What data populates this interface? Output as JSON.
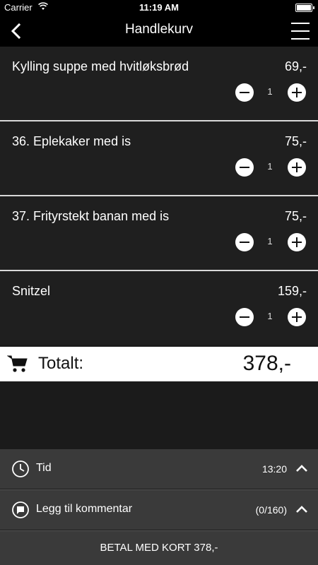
{
  "status_bar": {
    "carrier": "Carrier",
    "time": "11:19 AM"
  },
  "nav": {
    "title": "Handlekurv"
  },
  "items": [
    {
      "name": "Kylling suppe med hvitløksbrød",
      "price": "69,-",
      "qty": "1"
    },
    {
      "name": "36. Eplekaker med is",
      "price": "75,-",
      "qty": "1"
    },
    {
      "name": "37. Frityrstekt banan med is",
      "price": "75,-",
      "qty": "1"
    },
    {
      "name": "Snitzel",
      "price": "159,-",
      "qty": "1"
    }
  ],
  "total": {
    "label": "Totalt:",
    "value": "378,-"
  },
  "options": {
    "time": {
      "label": "Tid",
      "value": "13:20"
    },
    "comment": {
      "label": "Legg til kommentar",
      "value": "(0/160)"
    }
  },
  "pay_button": {
    "label": "BETAL MED KORT 378,-"
  },
  "icons": {
    "back": "chevron-left-icon",
    "menu": "hamburger-menu-icon",
    "cart": "shopping-cart-icon",
    "clock": "clock-icon",
    "comment": "comment-bubble-icon",
    "chevron": "chevron-up-icon"
  },
  "colors": {
    "background": "#1b1b1b",
    "bar": "#000000",
    "options_bg": "#3a3a3a",
    "total_bg": "#ffffff"
  }
}
